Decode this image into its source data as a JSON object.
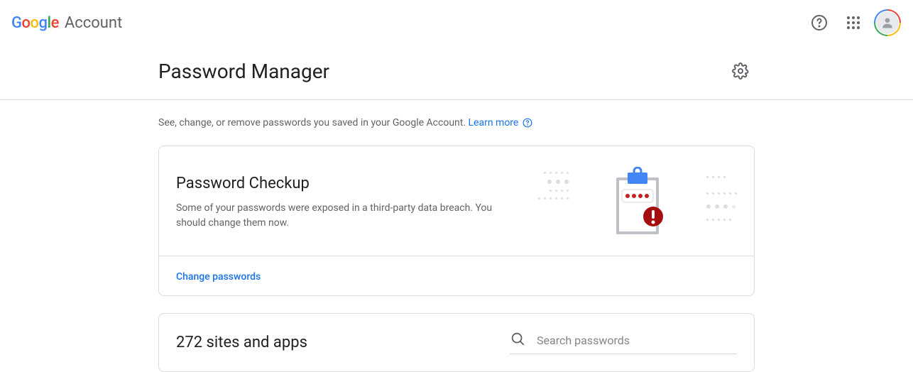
{
  "header": {
    "product_label": "Account"
  },
  "page": {
    "title": "Password Manager",
    "intro_prefix": "See, change, or remove passwords you saved in your Google Account. ",
    "learn_more": "Learn more"
  },
  "checkup": {
    "title": "Password Checkup",
    "description": "Some of your passwords were exposed in a third-party data breach. You should change them now.",
    "action_label": "Change passwords"
  },
  "sites": {
    "title": "272 sites and apps",
    "search_placeholder": "Search passwords"
  }
}
